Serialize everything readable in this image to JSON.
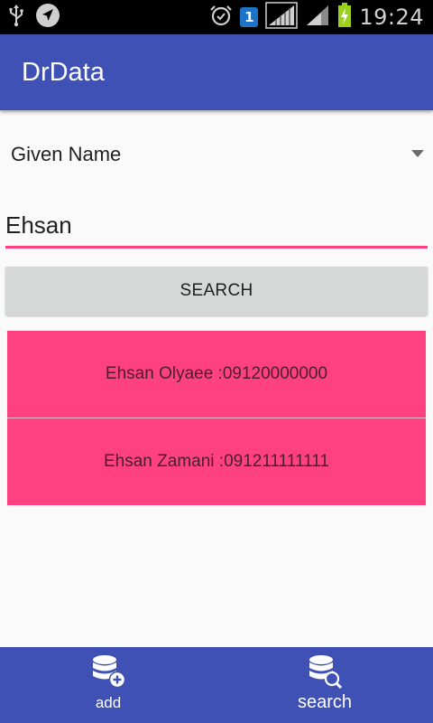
{
  "status_bar": {
    "time": "19:24",
    "sim_number": "1",
    "icons": [
      "usb-icon",
      "navigation-icon",
      "alarm-icon",
      "sim-icon",
      "signal-icon",
      "wifi-signal-icon",
      "battery-charging-icon"
    ]
  },
  "app": {
    "title": "DrData"
  },
  "filter": {
    "selected": "Given Name"
  },
  "search": {
    "value": "Ehsan",
    "button_label": "SEARCH"
  },
  "results": [
    {
      "text": "Ehsan Olyaee :09120000000"
    },
    {
      "text": "Ehsan Zamani :091211111111"
    }
  ],
  "bottom_nav": {
    "add_label": "add",
    "search_label": "search"
  },
  "colors": {
    "primary": "#3f51b5",
    "accent": "#ff4081",
    "button": "#d6d7d7",
    "background": "#fafafa"
  }
}
